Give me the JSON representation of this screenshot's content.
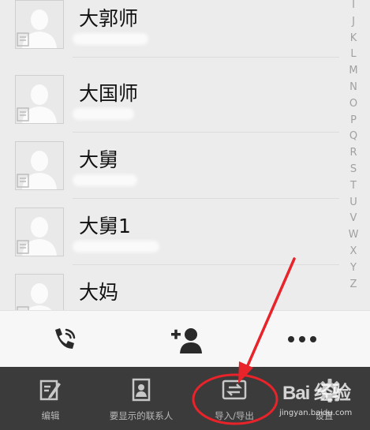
{
  "contacts": [
    {
      "name": "大郭师"
    },
    {
      "name": "大国师"
    },
    {
      "name": "大舅"
    },
    {
      "name": "大舅1"
    },
    {
      "name": "大妈"
    }
  ],
  "alphabet_index": [
    "I",
    "J",
    "K",
    "L",
    "M",
    "N",
    "O",
    "P",
    "Q",
    "R",
    "S",
    "T",
    "U",
    "V",
    "W",
    "X",
    "Y",
    "Z"
  ],
  "action_bar": {
    "icons": [
      "phone-icon",
      "add-contact-icon",
      "more-icon"
    ]
  },
  "bottom_menu": [
    {
      "label": "编辑",
      "icon": "edit-icon"
    },
    {
      "label": "要显示的联系人",
      "icon": "contact-card-icon"
    },
    {
      "label": "导入/导出",
      "icon": "import-export-icon"
    },
    {
      "label": "设置",
      "icon": "gear-icon"
    }
  ],
  "watermark": {
    "main": "Bai 经验",
    "sub": "jingyan.baidu.com"
  },
  "colors": {
    "annotation_red": "#e8232a",
    "menu_background": "#3b3b3b",
    "list_background": "#ececec"
  }
}
